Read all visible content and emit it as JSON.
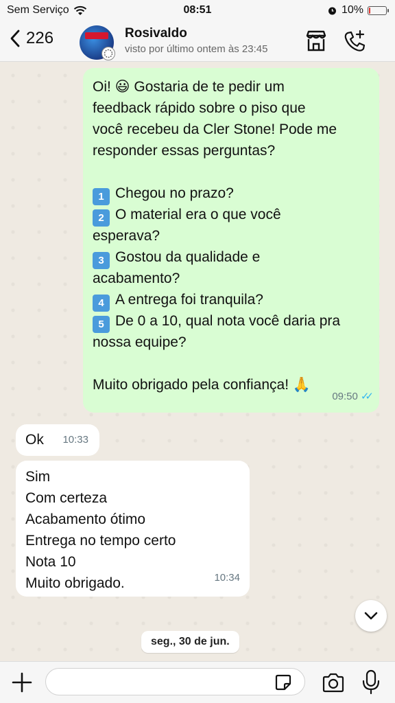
{
  "status_bar": {
    "carrier": "Sem Serviço",
    "time": "08:51",
    "battery_text": "10%",
    "battery_level": 0.1
  },
  "header": {
    "back_count": "226",
    "contact_name": "Rosivaldo",
    "contact_status": "visto por último ontem às 23:45",
    "icons": [
      "chevron-left-icon",
      "store-icon",
      "phone-plus-icon"
    ]
  },
  "messages": {
    "outgoing": {
      "lines": [
        "Oi! 😃 Gostaria de te pedir um",
        "feedback rápido sobre o piso que",
        "você recebeu da Cler Stone! Pode me",
        "responder essas perguntas?",
        "",
        "Chegou no prazo?",
        "O material era o que você",
        "esperava?",
        "Gostou da qualidade e",
        "acabamento?",
        "A entrega foi tranquila?",
        "De 0 a 10, qual nota você daria pra",
        "nossa equipe?",
        "",
        "Muito obrigado pela confiança! 🙏"
      ],
      "badges": [
        "1",
        "2",
        "3",
        "4",
        "5"
      ],
      "time": "09:50",
      "read_ticks": "✓✓"
    },
    "incoming_1": {
      "text": "Ok",
      "time": "10:33"
    },
    "incoming_2": {
      "lines": [
        "Sim",
        "Com certeza",
        "Acabamento ótimo",
        "Entrega no tempo certo",
        "Nota 10",
        "Muito obrigado."
      ],
      "time": "10:34"
    }
  },
  "date_pill": "seg., 30 de jun.",
  "composer": {
    "placeholder": ""
  },
  "colors": {
    "outgoing_bubble": "#d9fdd3",
    "incoming_bubble": "#ffffff",
    "chat_bg": "#efeae2",
    "ticks": "#34b7f1"
  }
}
